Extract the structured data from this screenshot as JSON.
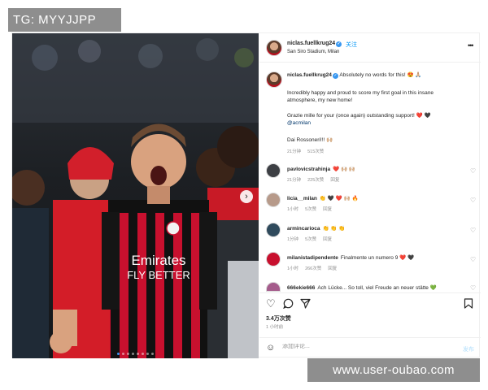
{
  "watermark_top": "TG: MYYJJPP",
  "watermark_bottom": "www.user-oubao.com",
  "post": {
    "username": "niclas.fuellkrug24",
    "follow_label": "关注",
    "location": "San Siro Stadium, Milan",
    "more_label": "•••",
    "photo_alt": "Celebration photo",
    "jersey_text_1": "Emirates",
    "jersey_text_2": "FLY BETTER",
    "carousel_count": 8
  },
  "caption": {
    "username": "niclas.fuellkrug24",
    "line1": "Absolutely no words for this! 😍 🙏🏼",
    "line2": "Incredibly happy and proud to score my first goal in this insane",
    "line3": "atmosphere, my new home!",
    "line4": "Grazie mille for your (once again) outstanding support! ❤️ 🖤",
    "line5": "@acmilan",
    "line6": "Dai Rossoneri!!! 🙌🏼",
    "time": "21分钟",
    "likes": "515次赞"
  },
  "comments": [
    {
      "username": "pavlovicstrahinja",
      "text": "❤️ 🙌🏼 🙌🏼",
      "time": "21分钟",
      "likes": "225次赞",
      "reply": "回复"
    },
    {
      "username": "licia__milan",
      "text": "👏 🖤 ❤️ 🙌🏼 🔥",
      "time": "1小时",
      "likes": "5次赞",
      "reply": "回复"
    },
    {
      "username": "armincarioca",
      "text": "👏 👏 👏",
      "time": "1分钟",
      "likes": "5次赞",
      "reply": "回复"
    },
    {
      "username": "milanistadipendente",
      "text": "Finalmente un numero 9 ❤️ 🖤",
      "time": "1小时",
      "likes": "266次赞",
      "reply": "回复"
    },
    {
      "username": "666ekie666",
      "text": "Ach Lücke... So toll, viel Freude an neuer stätte 💚",
      "time": "",
      "likes": "",
      "reply": ""
    }
  ],
  "stats": {
    "likes": "3.4万次赞",
    "time_ago": "1 小时前"
  },
  "composer": {
    "placeholder": "添加评论...",
    "post_label": "发布"
  },
  "icons": {
    "like": "heart-icon",
    "comment": "comment-icon",
    "share": "share-icon",
    "save": "bookmark-icon",
    "emoji": "emoji-icon",
    "next": "chevron-right-icon",
    "verified": "verified-badge-icon"
  },
  "colors": {
    "ac_milan_red": "#c8102e",
    "ac_milan_black": "#111111",
    "link_blue": "#0095f6",
    "watermark_gray": "#8e8e8e"
  }
}
